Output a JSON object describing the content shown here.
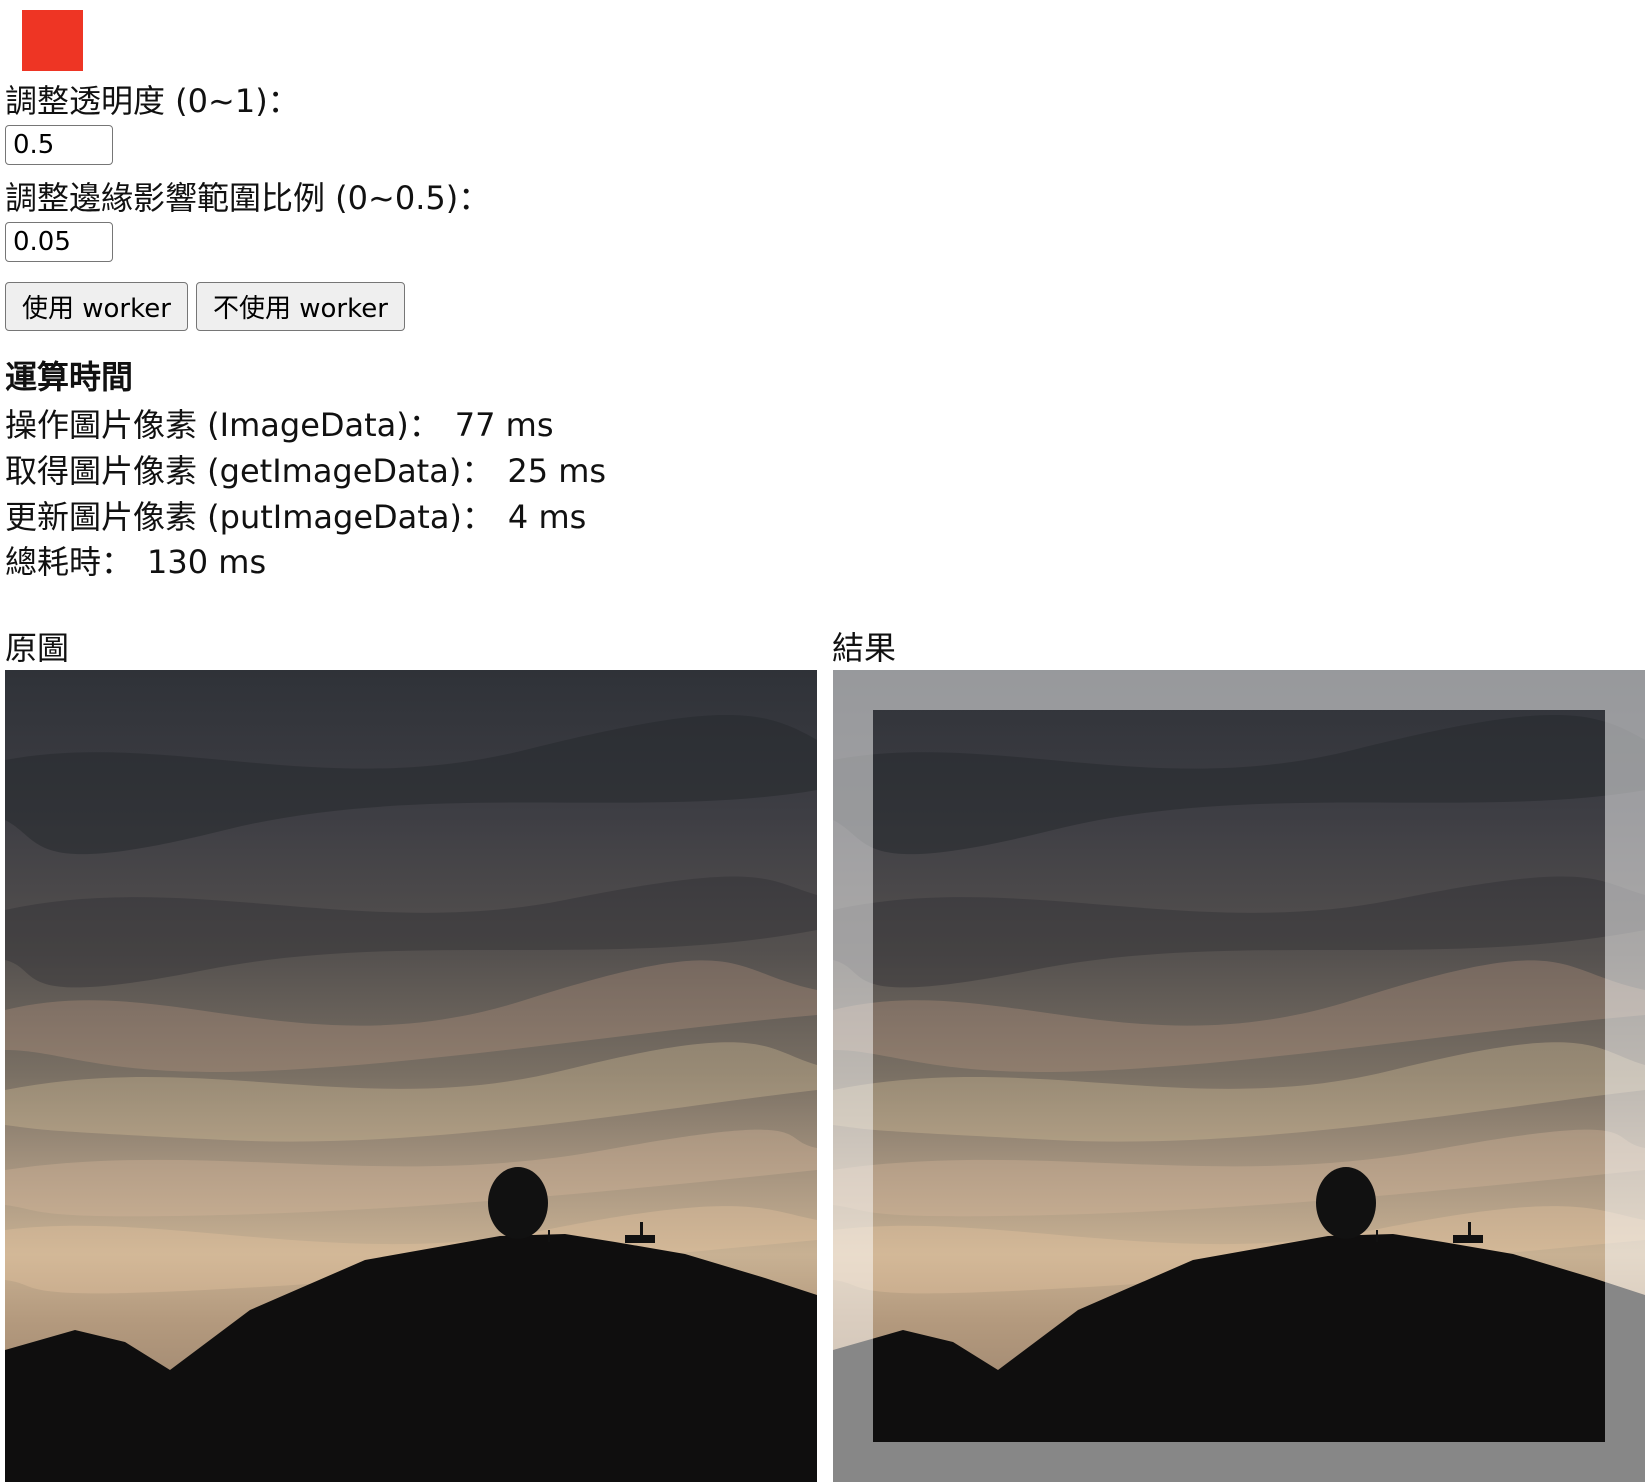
{
  "colors": {
    "swatch": "#ee3524"
  },
  "controls": {
    "opacity_label": "調整透明度 (0~1)：",
    "opacity_value": "0.5",
    "edge_label": "調整邊緣影響範圍比例 (0~0.5)：",
    "edge_value": "0.05",
    "use_worker_label": "使用 worker",
    "no_worker_label": "不使用 worker"
  },
  "timing": {
    "heading": "運算時間",
    "manipulate_label": "操作圖片像素 (ImageData)：",
    "manipulate_value": "77 ms",
    "get_label": "取得圖片像素 (getImageData)：",
    "get_value": "25 ms",
    "put_label": "更新圖片像素 (putImageData)：",
    "put_value": "4 ms",
    "total_label": "總耗時：",
    "total_value": "130 ms"
  },
  "images": {
    "original_label": "原圖",
    "result_label": "結果"
  }
}
